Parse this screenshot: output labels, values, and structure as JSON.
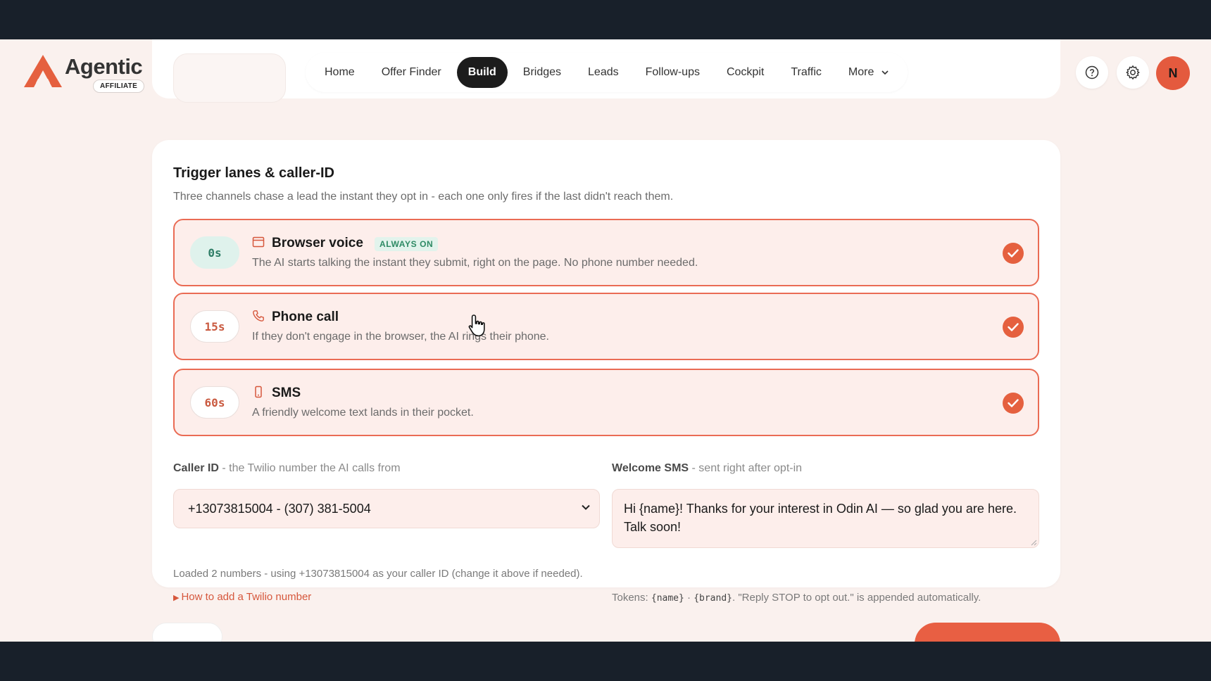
{
  "brand": {
    "name": "Agentic",
    "badge": "AFFILIATE"
  },
  "nav": {
    "items": [
      {
        "label": "Home",
        "active": false
      },
      {
        "label": "Offer Finder",
        "active": false
      },
      {
        "label": "Build",
        "active": true
      },
      {
        "label": "Bridges",
        "active": false
      },
      {
        "label": "Leads",
        "active": false
      },
      {
        "label": "Follow-ups",
        "active": false
      },
      {
        "label": "Cockpit",
        "active": false
      },
      {
        "label": "Traffic",
        "active": false
      },
      {
        "label": "More",
        "active": false
      }
    ],
    "help_icon": "help-circle-icon",
    "settings_icon": "gear-icon",
    "avatar_initial": "N"
  },
  "section": {
    "title": "Trigger lanes & caller-ID",
    "subtitle": "Three channels chase a lead the instant they opt in - each one only fires if the last didn't reach them.",
    "lanes": [
      {
        "time": "0s",
        "name": "Browser voice",
        "badge": "ALWAYS ON",
        "desc": "The AI starts talking the instant they submit, right on the page. No phone number needed.",
        "icon": "browser-icon",
        "checked": true
      },
      {
        "time": "15s",
        "name": "Phone call",
        "desc": "If they don't engage in the browser, the AI rings their phone.",
        "icon": "phone-icon",
        "checked": true
      },
      {
        "time": "60s",
        "name": "SMS",
        "desc": "A friendly welcome text lands in their pocket.",
        "icon": "mobile-icon",
        "checked": true
      }
    ]
  },
  "caller_id": {
    "label": "Caller ID",
    "label_hint": "- the Twilio number the AI calls from",
    "value": "+13073815004 - (307) 381-5004",
    "helper": "Loaded 2 numbers - using +13073815004 as your caller ID (change it above if needed).",
    "howto": "How to add a Twilio number"
  },
  "welcome_sms": {
    "label": "Welcome SMS",
    "label_hint": "- sent right after opt-in",
    "value": "Hi {name}! Thanks for your interest in Odin AI — so glad you are here. Talk soon!",
    "tokens_prefix": "Tokens:",
    "token_name": "{name}",
    "token_sep": "·",
    "token_brand": "{brand}",
    "tokens_suffix": ". \"Reply STOP to opt out.\" is appended automatically."
  },
  "colors": {
    "accent": "#e5603f",
    "lane_bg": "#fdeeeb",
    "page_bg": "#faf1ee",
    "badge_green": "#2e8a64"
  }
}
